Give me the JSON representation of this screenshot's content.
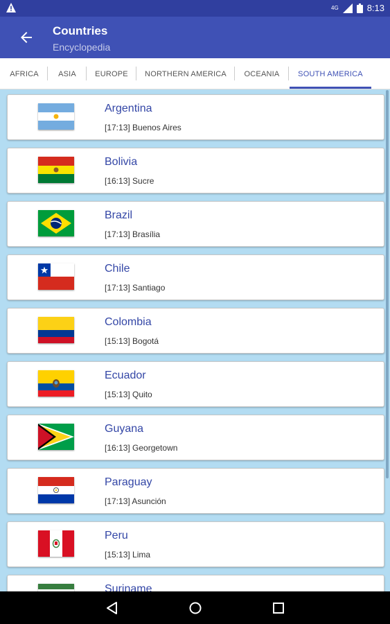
{
  "status": {
    "time": "8:13",
    "network": "4G"
  },
  "header": {
    "title": "Countries",
    "subtitle": "Encyclopedia"
  },
  "tabs": [
    {
      "label": "AFRICA"
    },
    {
      "label": "ASIA"
    },
    {
      "label": "EUROPE"
    },
    {
      "label": "NORTHERN AMERICA"
    },
    {
      "label": "OCEANIA"
    },
    {
      "label": "SOUTH AMERICA"
    }
  ],
  "countries": [
    {
      "name": "Argentina",
      "capital": "[17:13] Buenos Aires"
    },
    {
      "name": "Bolivia",
      "capital": "[16:13] Sucre"
    },
    {
      "name": "Brazil",
      "capital": "[17:13] Brasília"
    },
    {
      "name": "Chile",
      "capital": "[17:13] Santiago"
    },
    {
      "name": "Colombia",
      "capital": "[15:13] Bogotá"
    },
    {
      "name": "Ecuador",
      "capital": "[15:13] Quito"
    },
    {
      "name": "Guyana",
      "capital": "[16:13] Georgetown"
    },
    {
      "name": "Paraguay",
      "capital": "[17:13] Asunción"
    },
    {
      "name": "Peru",
      "capital": "[15:13] Lima"
    },
    {
      "name": "Suriname",
      "capital": ""
    }
  ],
  "colors": {
    "primary": "#3f51b5",
    "primary_dark": "#303f9f",
    "list_bg": "#b3dcf2",
    "name_text": "#3346a6"
  }
}
